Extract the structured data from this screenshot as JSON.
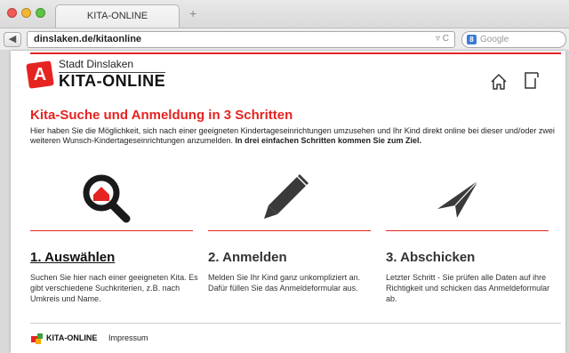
{
  "browser": {
    "tab_title": "KITA-ONLINE",
    "new_tab": "+",
    "url": "dinslaken.de/kitaonline",
    "search_placeholder": "Google",
    "reload": "▿ C"
  },
  "header": {
    "city": "Stadt Dinslaken",
    "brand": "KITA-ONLINE",
    "logo_letter": "A"
  },
  "main": {
    "title": "Kita-Suche und Anmeldung in 3 Schritten",
    "intro": "Hier haben Sie die Möglichkeit, sich nach einer geeigneten Kindertageseinrichtungen umzusehen und Ihr Kind direkt online bei dieser und/oder zwei weiteren Wunsch-Kindertageseinrichtungen anzumelden.",
    "intro_bold": "In drei einfachen Schritten kommen Sie zum Ziel.",
    "steps": [
      {
        "title": "1. Auswählen",
        "text": "Suchen Sie hier nach einer geeigneten Kita. Es gibt verschiedene Suchkriterien, z.B. nach Umkreis und Name.",
        "icon": "magnifier-house-icon"
      },
      {
        "title": "2. Anmelden",
        "text": "Melden Sie Ihr Kind ganz unkompliziert an. Dafür füllen Sie das Anmeldeformular aus.",
        "icon": "pencil-icon"
      },
      {
        "title": "3. Abschicken",
        "text": "Letzter Schritt - Sie prüfen alle Daten auf ihre Richtigkeit und schicken das Anmeldeformular ab.",
        "icon": "paper-plane-icon"
      }
    ]
  },
  "footer": {
    "brand": "KITA-ONLINE",
    "link": "Impressum"
  },
  "colors": {
    "accent": "#e52421"
  }
}
